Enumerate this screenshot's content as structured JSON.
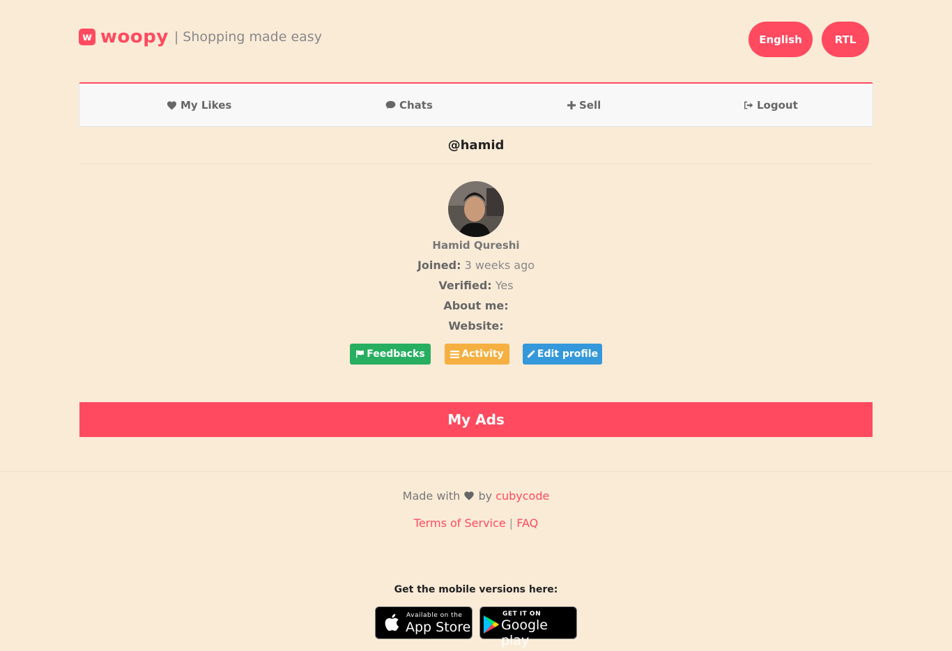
{
  "header": {
    "logo_letter": "w",
    "brand": "woopy",
    "tagline": "| Shopping made easy",
    "english_label": "English",
    "rtl_label": "RTL"
  },
  "nav": {
    "likes": "My Likes",
    "chats": "Chats",
    "sell": "Sell",
    "logout": "Logout"
  },
  "profile": {
    "username": "@hamid",
    "name": "Hamid Qureshi",
    "joined_label": "Joined:",
    "joined_value": "3 weeks ago",
    "verified_label": "Verified:",
    "verified_value": "Yes",
    "about_label": "About me:",
    "website_label": "Website:",
    "feedbacks_label": "Feedbacks",
    "activity_label": "Activity",
    "edit_label": "Edit profile"
  },
  "my_ads": "My Ads",
  "footer": {
    "made_with": "Made with",
    "by": "by",
    "author": "cubycode",
    "terms": "Terms of Service",
    "sep": "|",
    "faq": "FAQ",
    "mobile_text": "Get the mobile versions here:",
    "appstore_small": "Available on the",
    "appstore_big": "App Store",
    "gplay_small": "GET IT ON",
    "gplay_big": "Google play"
  },
  "colors": {
    "background": "#faebd7",
    "accent": "#ff4a5f",
    "feedbacks": "#27ae60",
    "activity": "#f5b041",
    "edit": "#3498db"
  },
  "icons": {
    "likes": "heart-icon",
    "chats": "comment-icon",
    "sell": "plus-icon",
    "logout": "sign-out-icon",
    "feedbacks": "flag-icon",
    "activity": "list-icon",
    "edit": "pencil-icon"
  }
}
